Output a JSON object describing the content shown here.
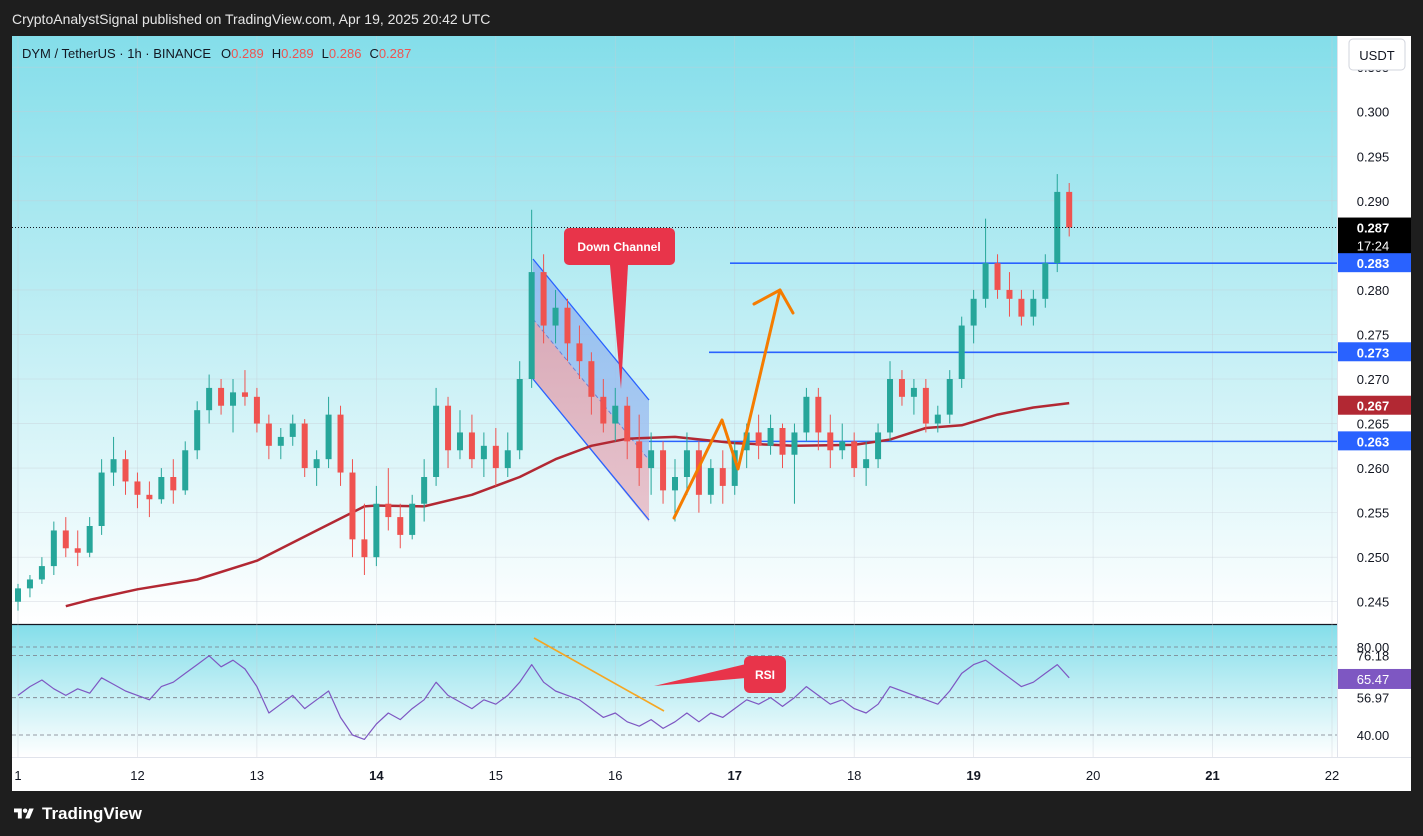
{
  "header": {
    "publish_line": "CryptoAnalystSignal published on TradingView.com, Apr 19, 2025 20:42 UTC"
  },
  "footer": {
    "brand": "TradingView"
  },
  "chart_data": [
    {
      "type": "candlestick",
      "legend": {
        "symbol": "DYM / TetherUS · 1h · BINANCE",
        "o_label": "O",
        "o_value": "0.289",
        "h_label": "H",
        "h_value": "0.289",
        "l_label": "L",
        "l_value": "0.286",
        "c_label": "C",
        "c_value": "0.287"
      },
      "currency_button": "USDT",
      "ylim": [
        0.2425,
        0.3085
      ],
      "y_ticks": [
        "0.305",
        "0.300",
        "0.295",
        "0.290",
        "0.280",
        "0.275",
        "0.270",
        "0.265",
        "0.260",
        "0.255",
        "0.250",
        "0.245"
      ],
      "x_ticks": [
        "1",
        "12",
        "13",
        "14",
        "15",
        "16",
        "17",
        "18",
        "19",
        "20",
        "21",
        "22"
      ],
      "x_range": [
        11,
        22
      ],
      "last_price": "0.287",
      "countdown": "17:24",
      "moving_average_value": "0.267",
      "horizontal_levels": [
        {
          "value": 0.283,
          "label": "0.283"
        },
        {
          "value": 0.273,
          "label": "0.273"
        },
        {
          "value": 0.263,
          "label": "0.263"
        }
      ],
      "annotations": {
        "down_channel": "Down Channel",
        "rsi_callout": "RSI"
      },
      "candles": [
        [
          11.0,
          0.245,
          0.247,
          0.244,
          0.2465
        ],
        [
          11.1,
          0.2465,
          0.248,
          0.2455,
          0.2475
        ],
        [
          11.2,
          0.2475,
          0.25,
          0.247,
          0.249
        ],
        [
          11.3,
          0.249,
          0.254,
          0.248,
          0.253
        ],
        [
          11.4,
          0.253,
          0.2545,
          0.25,
          0.251
        ],
        [
          11.5,
          0.251,
          0.253,
          0.249,
          0.2505
        ],
        [
          11.6,
          0.2505,
          0.2545,
          0.25,
          0.2535
        ],
        [
          11.7,
          0.2535,
          0.261,
          0.2525,
          0.2595
        ],
        [
          11.8,
          0.2595,
          0.2635,
          0.258,
          0.261
        ],
        [
          11.9,
          0.261,
          0.262,
          0.257,
          0.2585
        ],
        [
          12.0,
          0.2585,
          0.2595,
          0.2555,
          0.257
        ],
        [
          12.1,
          0.257,
          0.2585,
          0.2545,
          0.2565
        ],
        [
          12.2,
          0.2565,
          0.26,
          0.256,
          0.259
        ],
        [
          12.3,
          0.259,
          0.261,
          0.256,
          0.2575
        ],
        [
          12.4,
          0.2575,
          0.263,
          0.257,
          0.262
        ],
        [
          12.5,
          0.262,
          0.2675,
          0.261,
          0.2665
        ],
        [
          12.6,
          0.2665,
          0.2705,
          0.265,
          0.269
        ],
        [
          12.7,
          0.269,
          0.27,
          0.266,
          0.267
        ],
        [
          12.8,
          0.267,
          0.27,
          0.264,
          0.2685
        ],
        [
          12.9,
          0.2685,
          0.271,
          0.267,
          0.268
        ],
        [
          13.0,
          0.268,
          0.269,
          0.264,
          0.265
        ],
        [
          13.1,
          0.265,
          0.266,
          0.261,
          0.2625
        ],
        [
          13.2,
          0.2625,
          0.2645,
          0.261,
          0.2635
        ],
        [
          13.3,
          0.2635,
          0.266,
          0.2625,
          0.265
        ],
        [
          13.4,
          0.265,
          0.2655,
          0.259,
          0.26
        ],
        [
          13.5,
          0.26,
          0.262,
          0.258,
          0.261
        ],
        [
          13.6,
          0.261,
          0.268,
          0.26,
          0.266
        ],
        [
          13.7,
          0.266,
          0.267,
          0.258,
          0.2595
        ],
        [
          13.8,
          0.2595,
          0.261,
          0.25,
          0.252
        ],
        [
          13.9,
          0.252,
          0.256,
          0.248,
          0.25
        ],
        [
          14.0,
          0.25,
          0.258,
          0.249,
          0.256
        ],
        [
          14.1,
          0.256,
          0.26,
          0.253,
          0.2545
        ],
        [
          14.2,
          0.2545,
          0.256,
          0.251,
          0.2525
        ],
        [
          14.3,
          0.2525,
          0.257,
          0.252,
          0.256
        ],
        [
          14.4,
          0.256,
          0.261,
          0.254,
          0.259
        ],
        [
          14.5,
          0.259,
          0.269,
          0.258,
          0.267
        ],
        [
          14.6,
          0.267,
          0.268,
          0.26,
          0.262
        ],
        [
          14.7,
          0.262,
          0.2665,
          0.261,
          0.264
        ],
        [
          14.8,
          0.264,
          0.266,
          0.26,
          0.261
        ],
        [
          14.9,
          0.261,
          0.264,
          0.259,
          0.2625
        ],
        [
          15.0,
          0.2625,
          0.2645,
          0.258,
          0.26
        ],
        [
          15.1,
          0.26,
          0.264,
          0.259,
          0.262
        ],
        [
          15.2,
          0.262,
          0.272,
          0.261,
          0.27
        ],
        [
          15.3,
          0.27,
          0.289,
          0.269,
          0.282
        ],
        [
          15.4,
          0.282,
          0.284,
          0.274,
          0.276
        ],
        [
          15.5,
          0.276,
          0.28,
          0.274,
          0.278
        ],
        [
          15.6,
          0.278,
          0.279,
          0.272,
          0.274
        ],
        [
          15.7,
          0.274,
          0.276,
          0.27,
          0.272
        ],
        [
          15.8,
          0.272,
          0.273,
          0.266,
          0.268
        ],
        [
          15.9,
          0.268,
          0.27,
          0.264,
          0.265
        ],
        [
          16.0,
          0.265,
          0.269,
          0.263,
          0.267
        ],
        [
          16.1,
          0.267,
          0.268,
          0.261,
          0.263
        ],
        [
          16.2,
          0.263,
          0.266,
          0.258,
          0.26
        ],
        [
          16.3,
          0.26,
          0.264,
          0.257,
          0.262
        ],
        [
          16.4,
          0.262,
          0.263,
          0.256,
          0.2575
        ],
        [
          16.5,
          0.2575,
          0.261,
          0.254,
          0.259
        ],
        [
          16.6,
          0.259,
          0.264,
          0.257,
          0.262
        ],
        [
          16.7,
          0.262,
          0.263,
          0.255,
          0.257
        ],
        [
          16.8,
          0.257,
          0.261,
          0.256,
          0.26
        ],
        [
          16.9,
          0.26,
          0.262,
          0.256,
          0.258
        ],
        [
          17.0,
          0.258,
          0.263,
          0.257,
          0.262
        ],
        [
          17.1,
          0.262,
          0.265,
          0.26,
          0.264
        ],
        [
          17.2,
          0.264,
          0.266,
          0.261,
          0.2625
        ],
        [
          17.3,
          0.2625,
          0.266,
          0.2615,
          0.2645
        ],
        [
          17.4,
          0.2645,
          0.265,
          0.26,
          0.2615
        ],
        [
          17.5,
          0.2615,
          0.265,
          0.256,
          0.264
        ],
        [
          17.6,
          0.264,
          0.269,
          0.263,
          0.268
        ],
        [
          17.7,
          0.268,
          0.269,
          0.262,
          0.264
        ],
        [
          17.8,
          0.264,
          0.266,
          0.26,
          0.262
        ],
        [
          17.9,
          0.262,
          0.265,
          0.261,
          0.263
        ],
        [
          18.0,
          0.263,
          0.264,
          0.259,
          0.26
        ],
        [
          18.1,
          0.26,
          0.263,
          0.258,
          0.261
        ],
        [
          18.2,
          0.261,
          0.265,
          0.26,
          0.264
        ],
        [
          18.3,
          0.264,
          0.272,
          0.263,
          0.27
        ],
        [
          18.4,
          0.27,
          0.271,
          0.267,
          0.268
        ],
        [
          18.5,
          0.268,
          0.27,
          0.266,
          0.269
        ],
        [
          18.6,
          0.269,
          0.27,
          0.264,
          0.265
        ],
        [
          18.7,
          0.265,
          0.267,
          0.264,
          0.266
        ],
        [
          18.8,
          0.266,
          0.271,
          0.265,
          0.27
        ],
        [
          18.9,
          0.27,
          0.277,
          0.269,
          0.276
        ],
        [
          19.0,
          0.276,
          0.28,
          0.274,
          0.279
        ],
        [
          19.1,
          0.279,
          0.288,
          0.278,
          0.283
        ],
        [
          19.2,
          0.283,
          0.284,
          0.279,
          0.28
        ],
        [
          19.3,
          0.28,
          0.282,
          0.277,
          0.279
        ],
        [
          19.4,
          0.279,
          0.28,
          0.276,
          0.277
        ],
        [
          19.5,
          0.277,
          0.28,
          0.276,
          0.279
        ],
        [
          19.6,
          0.279,
          0.284,
          0.278,
          0.283
        ],
        [
          19.7,
          0.283,
          0.293,
          0.282,
          0.291
        ],
        [
          19.8,
          0.291,
          0.292,
          0.286,
          0.287
        ]
      ],
      "moving_average": [
        [
          11.4,
          0.2445
        ],
        [
          11.6,
          0.2452
        ],
        [
          12.0,
          0.2464
        ],
        [
          12.5,
          0.2475
        ],
        [
          13.0,
          0.2496
        ],
        [
          13.5,
          0.253
        ],
        [
          13.9,
          0.2557
        ],
        [
          14.0,
          0.2558
        ],
        [
          14.4,
          0.2557
        ],
        [
          14.8,
          0.257
        ],
        [
          15.2,
          0.259
        ],
        [
          15.5,
          0.261
        ],
        [
          15.8,
          0.2625
        ],
        [
          16.1,
          0.2633
        ],
        [
          16.5,
          0.2635
        ],
        [
          17.0,
          0.2628
        ],
        [
          17.5,
          0.2625
        ],
        [
          18.0,
          0.2626
        ],
        [
          18.3,
          0.2632
        ],
        [
          18.6,
          0.2645
        ],
        [
          18.9,
          0.2648
        ],
        [
          19.2,
          0.266
        ],
        [
          19.5,
          0.2668
        ],
        [
          19.8,
          0.2673
        ]
      ]
    },
    {
      "type": "line",
      "name": "RSI",
      "ylim": [
        30,
        90
      ],
      "y_ticks": [
        "80.00",
        "76.18",
        "56.97",
        "40.00"
      ],
      "current_value": "65.47",
      "values": [
        [
          11.0,
          58
        ],
        [
          11.1,
          62
        ],
        [
          11.2,
          65
        ],
        [
          11.3,
          61
        ],
        [
          11.4,
          58
        ],
        [
          11.5,
          61
        ],
        [
          11.6,
          59
        ],
        [
          11.7,
          66
        ],
        [
          11.8,
          63
        ],
        [
          11.9,
          60
        ],
        [
          12.0,
          58
        ],
        [
          12.1,
          56
        ],
        [
          12.2,
          62
        ],
        [
          12.3,
          64
        ],
        [
          12.4,
          68
        ],
        [
          12.5,
          72
        ],
        [
          12.6,
          76
        ],
        [
          12.7,
          71
        ],
        [
          12.8,
          74
        ],
        [
          12.9,
          70
        ],
        [
          13.0,
          62
        ],
        [
          13.1,
          50
        ],
        [
          13.2,
          54
        ],
        [
          13.3,
          58
        ],
        [
          13.4,
          52
        ],
        [
          13.5,
          56
        ],
        [
          13.6,
          60
        ],
        [
          13.7,
          48
        ],
        [
          13.8,
          40
        ],
        [
          13.9,
          38
        ],
        [
          14.0,
          45
        ],
        [
          14.1,
          50
        ],
        [
          14.2,
          47
        ],
        [
          14.3,
          52
        ],
        [
          14.4,
          56
        ],
        [
          14.5,
          64
        ],
        [
          14.6,
          58
        ],
        [
          14.7,
          55
        ],
        [
          14.8,
          52
        ],
        [
          14.9,
          56
        ],
        [
          15.0,
          54
        ],
        [
          15.1,
          58
        ],
        [
          15.2,
          64
        ],
        [
          15.3,
          72
        ],
        [
          15.4,
          64
        ],
        [
          15.5,
          60
        ],
        [
          15.6,
          58
        ],
        [
          15.7,
          56
        ],
        [
          15.8,
          52
        ],
        [
          15.9,
          48
        ],
        [
          16.0,
          50
        ],
        [
          16.1,
          46
        ],
        [
          16.2,
          44
        ],
        [
          16.3,
          47
        ],
        [
          16.4,
          43
        ],
        [
          16.5,
          46
        ],
        [
          16.6,
          50
        ],
        [
          16.7,
          46
        ],
        [
          16.8,
          50
        ],
        [
          16.9,
          48
        ],
        [
          17.0,
          52
        ],
        [
          17.1,
          56
        ],
        [
          17.2,
          54
        ],
        [
          17.3,
          57
        ],
        [
          17.4,
          53
        ],
        [
          17.5,
          57
        ],
        [
          17.6,
          62
        ],
        [
          17.7,
          58
        ],
        [
          17.8,
          54
        ],
        [
          17.9,
          56
        ],
        [
          18.0,
          52
        ],
        [
          18.1,
          50
        ],
        [
          18.2,
          54
        ],
        [
          18.3,
          62
        ],
        [
          18.4,
          60
        ],
        [
          18.5,
          58
        ],
        [
          18.6,
          56
        ],
        [
          18.7,
          54
        ],
        [
          18.8,
          60
        ],
        [
          18.9,
          68
        ],
        [
          19.0,
          72
        ],
        [
          19.1,
          74
        ],
        [
          19.2,
          70
        ],
        [
          19.3,
          66
        ],
        [
          19.4,
          62
        ],
        [
          19.5,
          64
        ],
        [
          19.6,
          68
        ],
        [
          19.7,
          72
        ],
        [
          19.8,
          66
        ]
      ]
    }
  ],
  "style": {
    "up_color": "#26a69a",
    "down_color": "#ef5350",
    "ma_color": "#b22833",
    "level_color": "#2962ff",
    "rsi_color": "#7e57c2",
    "arrow_color": "#f57c00",
    "callout_color": "#e8344a",
    "bg_top": "#84deea",
    "bg_bottom": "#ffffff"
  }
}
